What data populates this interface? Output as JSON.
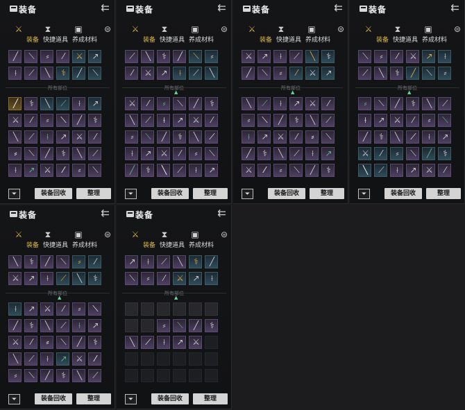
{
  "panel": {
    "title": "装备",
    "back_icon": "double-chevron-left-icon",
    "categories": [
      {
        "icon": "crossed-swords-icon",
        "glyph": "⚔",
        "active": true
      },
      {
        "icon": "hourglass-icon",
        "glyph": "⧗",
        "active": false
      },
      {
        "icon": "chest-icon",
        "glyph": "▣",
        "active": false
      },
      {
        "icon": "coin-stack-icon",
        "glyph": "⊜",
        "active": false
      }
    ],
    "tabs": [
      "装备",
      "快捷道具",
      "养成材料"
    ],
    "section_label": "所有部位",
    "recycle_label": "装备回收",
    "organize_label": "整理",
    "sort_icon": "filter-sort-icon"
  },
  "equipped_slots": [
    "p",
    "p",
    "p",
    "p",
    "b",
    "b",
    "p",
    "p",
    "p",
    "b",
    "b",
    "b"
  ],
  "panels": [
    {
      "grid": [
        "o",
        "p",
        "b",
        "b",
        "p",
        "b",
        "p",
        "p",
        "p",
        "p",
        "p",
        "p",
        "p",
        "p",
        "p",
        "p",
        "p",
        "p",
        "p",
        "p",
        "p",
        "p",
        "p",
        "p",
        "p",
        "p",
        "p",
        "p",
        "p",
        "p"
      ]
    },
    {
      "grid": [
        "p",
        "p",
        "p",
        "p",
        "p",
        "p",
        "p",
        "p",
        "p",
        "p",
        "p",
        "p",
        "p",
        "p",
        "p",
        "p",
        "p",
        "p",
        "p",
        "p",
        "p",
        "p",
        "p",
        "p",
        "p",
        "p",
        "p",
        "p",
        "p",
        "p"
      ]
    },
    {
      "grid": [
        "p",
        "p",
        "p",
        "p",
        "p",
        "p",
        "p",
        "p",
        "p",
        "p",
        "p",
        "p",
        "p",
        "p",
        "p",
        "p",
        "p",
        "p",
        "p",
        "p",
        "p",
        "p",
        "p",
        "p",
        "p",
        "p",
        "p",
        "p",
        "p",
        "p"
      ]
    },
    {
      "grid": [
        "p",
        "p",
        "p",
        "p",
        "p",
        "p",
        "p",
        "p",
        "p",
        "p",
        "p",
        "p",
        "p",
        "p",
        "p",
        "p",
        "p",
        "p",
        "b",
        "b",
        "b",
        "p",
        "b",
        "b",
        "b",
        "b",
        "p",
        "p",
        "p",
        "p"
      ]
    },
    {
      "grid": [
        "b",
        "p",
        "p",
        "p",
        "p",
        "p",
        "p",
        "p",
        "p",
        "p",
        "p",
        "p",
        "p",
        "p",
        "p",
        "p",
        "p",
        "p",
        "p",
        "p",
        "p",
        "b",
        "p",
        "p",
        "p",
        "p",
        "p",
        "p",
        "p",
        "p"
      ]
    },
    {
      "grid": [
        "d",
        "d",
        "d",
        "d",
        "d",
        "d",
        "d",
        "d",
        "p",
        "p",
        "p",
        "p",
        "p",
        "p",
        "p",
        "p",
        "p",
        "e",
        "e",
        "e",
        "e",
        "e",
        "e",
        "e",
        "e",
        "e",
        "e",
        "e",
        "e",
        "e"
      ]
    }
  ]
}
